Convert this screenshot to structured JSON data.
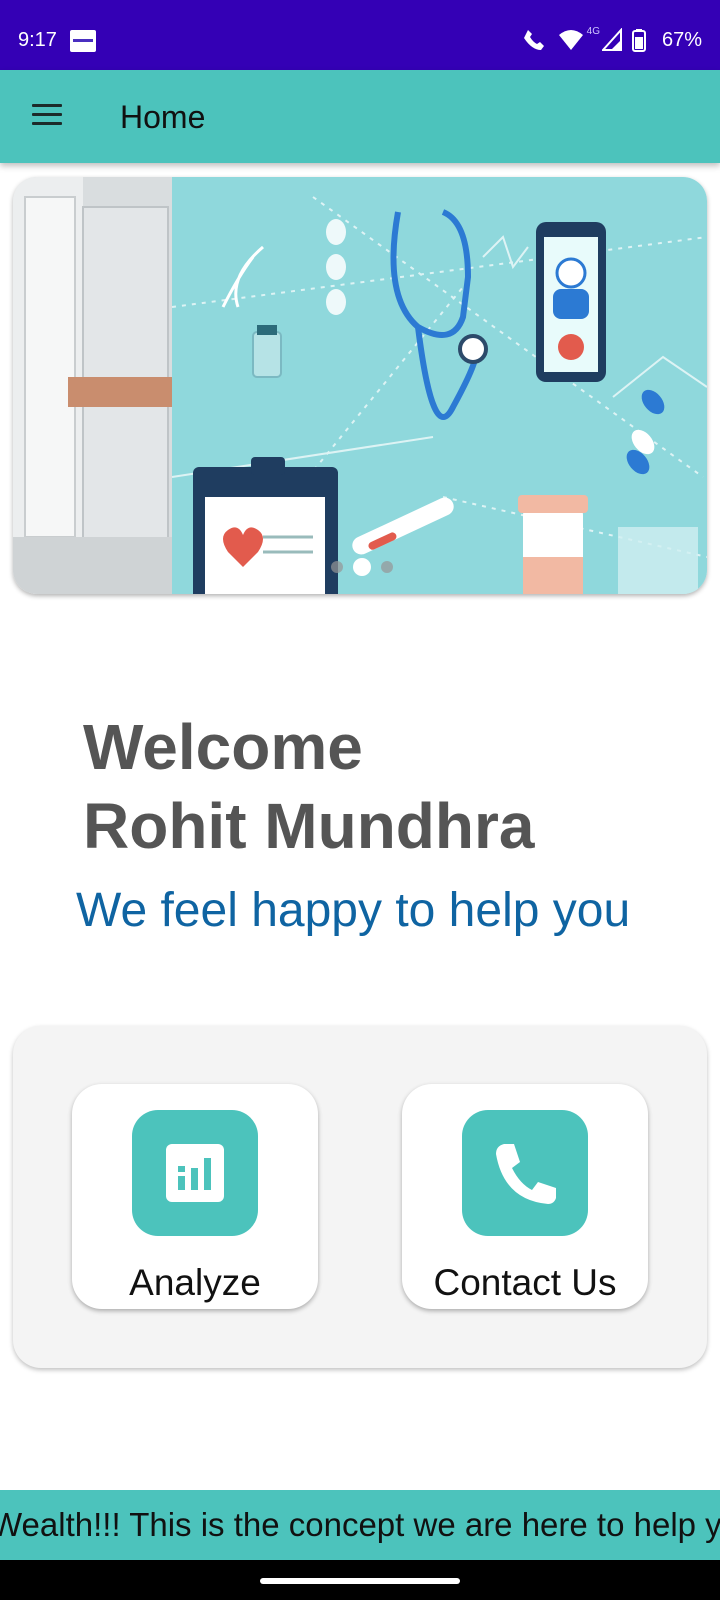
{
  "status_bar": {
    "time": "9:17",
    "network": "4G",
    "battery": "67%",
    "icons": [
      "app-notification-icon",
      "wifi-calling-icon",
      "wifi-icon",
      "signal-icon",
      "battery-icon"
    ]
  },
  "app_bar": {
    "title": "Home",
    "menu_icon": "hamburger-menu-icon"
  },
  "carousel": {
    "slide_count": 3,
    "active_slide": 1
  },
  "welcome": {
    "line1": "Welcome",
    "line2": "Rohit Mundhra",
    "tagline": "We feel happy to help you"
  },
  "actions": [
    {
      "label": "Analyze",
      "icon": "analytics-icon"
    },
    {
      "label": "Contact Us",
      "icon": "phone-icon"
    }
  ],
  "marquee": {
    "text": "Wealth!!! This is the concept we are here to help you"
  },
  "colors": {
    "status_bar": "#3400b5",
    "accent": "#4cc3bc",
    "tagline": "#0f64a2",
    "welcome_text": "#555555"
  }
}
